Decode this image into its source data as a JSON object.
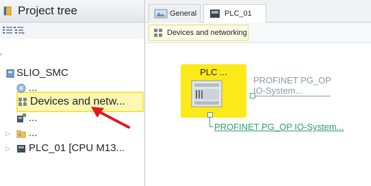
{
  "tree": {
    "title": "Project tree",
    "items": [
      {
        "label": "SLIO_SMC",
        "icon": "project-icon"
      },
      {
        "label": "...",
        "icon": "settings-globe-icon"
      },
      {
        "label": "Devices and netw...",
        "icon": "devices-network-icon"
      },
      {
        "label": "...",
        "icon": "device-add-icon"
      },
      {
        "label": "...",
        "icon": "folder-icon"
      },
      {
        "label": "PLC_01 [CPU M13...",
        "icon": "plc-icon"
      }
    ]
  },
  "tabs": [
    {
      "label": "General",
      "icon": "general-icon"
    },
    {
      "label": "PLC_01",
      "icon": "plc-icon"
    }
  ],
  "subtab": {
    "label": "Devices and networking",
    "icon": "devices-network-icon"
  },
  "network_view": {
    "plc_label": "PLC ...",
    "network_label_line1": "PROFINET PG_OP",
    "network_label_line2": "IO-System...",
    "io_system_link": "PROFINET PG_OP IO-System..."
  },
  "colors": {
    "selection_fill": "#fbf8b4",
    "selection_border": "#f7e24a",
    "plc_box": "#fbe91a",
    "network_gray": "#8d97a2",
    "io_green": "#2d9a68",
    "arrow_red": "#e0191d"
  }
}
